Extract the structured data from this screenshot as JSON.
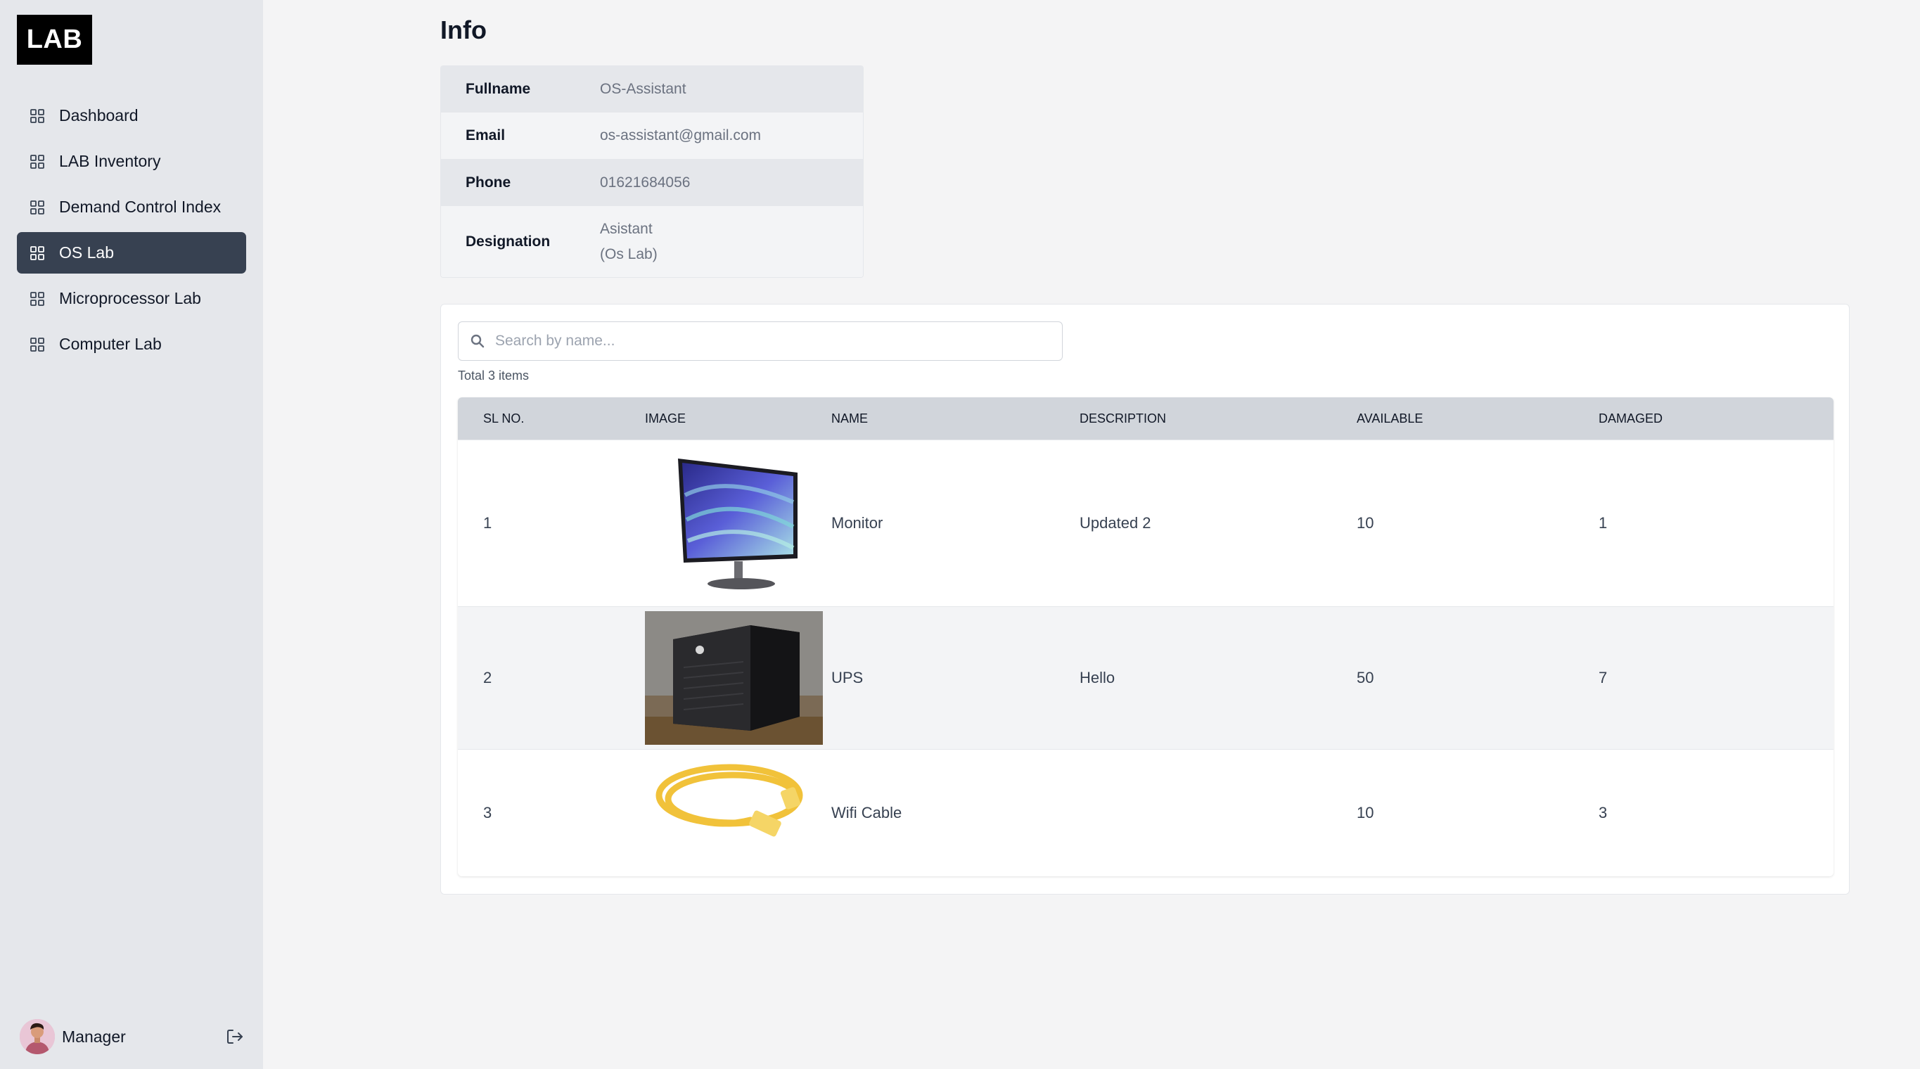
{
  "sidebar": {
    "logo": "LAB",
    "items": [
      {
        "label": "Dashboard",
        "active": false
      },
      {
        "label": "LAB Inventory",
        "active": false
      },
      {
        "label": "Demand Control Index",
        "active": false
      },
      {
        "label": "OS Lab",
        "active": true
      },
      {
        "label": "Microprocessor Lab",
        "active": false
      },
      {
        "label": "Computer Lab",
        "active": false
      }
    ],
    "user": {
      "name": "Manager"
    }
  },
  "main": {
    "title": "Info",
    "info": {
      "fullname_label": "Fullname",
      "fullname": "OS-Assistant",
      "email_label": "Email",
      "email": "os-assistant@gmail.com",
      "phone_label": "Phone",
      "phone": "01621684056",
      "designation_label": "Designation",
      "designation_line1": "Asistant",
      "designation_line2": "(Os Lab)"
    },
    "search": {
      "placeholder": "Search by name..."
    },
    "total": "Total 3 items",
    "table": {
      "headers": {
        "sl": "SL NO.",
        "image": "IMAGE",
        "name": "NAME",
        "description": "DESCRIPTION",
        "available": "AVAILABLE",
        "damaged": "DAMAGED"
      },
      "rows": [
        {
          "sl": "1",
          "name": "Monitor",
          "description": "Updated 2",
          "available": "10",
          "damaged": "1",
          "image": "monitor"
        },
        {
          "sl": "2",
          "name": "UPS",
          "description": "Hello",
          "available": "50",
          "damaged": "7",
          "image": "ups"
        },
        {
          "sl": "3",
          "name": "Wifi Cable",
          "description": "",
          "available": "10",
          "damaged": "3",
          "image": "ethernet-cable"
        }
      ]
    }
  },
  "colors": {
    "sidebar_bg": "#e5e7eb",
    "active_item": "#374151",
    "page_bg": "#f4f4f5",
    "table_header": "#d1d5db"
  }
}
